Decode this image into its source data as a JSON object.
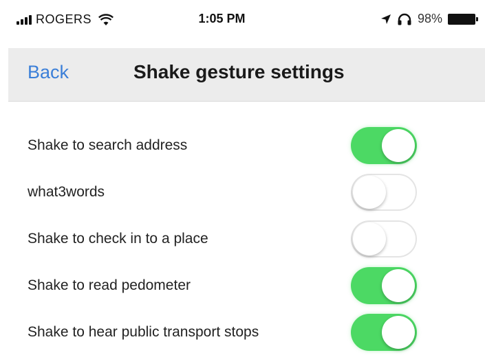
{
  "status_bar": {
    "carrier": "ROGERS",
    "time": "1:05 PM",
    "battery_percent": "98%",
    "icons": [
      "signal-icon",
      "wifi-icon",
      "location-arrow-icon",
      "headphones-icon",
      "battery-icon"
    ]
  },
  "nav": {
    "back_label": "Back",
    "title": "Shake gesture settings",
    "accent_color": "#3b7fd8"
  },
  "toggle_on_color": "#4cd964",
  "settings": [
    {
      "label": "Shake to search address",
      "enabled": true
    },
    {
      "label": "what3words",
      "enabled": false
    },
    {
      "label": "Shake to check in to a place",
      "enabled": false
    },
    {
      "label": "Shake to read pedometer",
      "enabled": true
    },
    {
      "label": "Shake to hear public transport stops",
      "enabled": true
    }
  ]
}
